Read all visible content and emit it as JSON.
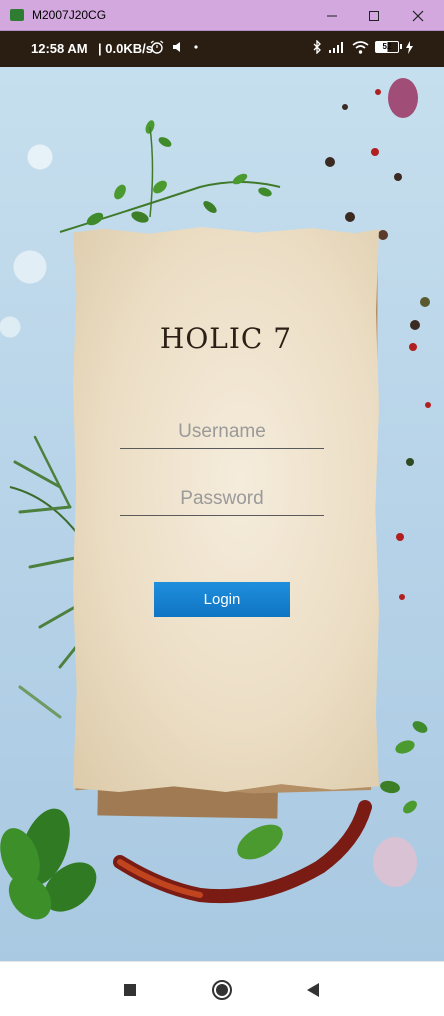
{
  "window": {
    "title": "M2007J20CG",
    "icons": [
      "app-icon",
      "minimize-icon",
      "maximize-icon",
      "close-icon"
    ]
  },
  "status_bar": {
    "time": "12:58 AM",
    "speed": "| 0.0KB/s",
    "battery": "52",
    "icons": [
      "alarm-icon",
      "volume-icon",
      "dot-icon",
      "bluetooth-icon",
      "signal-icon",
      "wifi-icon",
      "battery-icon",
      "charging-icon"
    ]
  },
  "login": {
    "app_title": "HOLIC 7",
    "username_placeholder": "Username",
    "username_value": "",
    "password_placeholder": "Password",
    "password_value": "",
    "login_label": "Login"
  },
  "nav_bar": {
    "icons": [
      "recent-apps-icon",
      "home-icon",
      "back-icon"
    ]
  }
}
